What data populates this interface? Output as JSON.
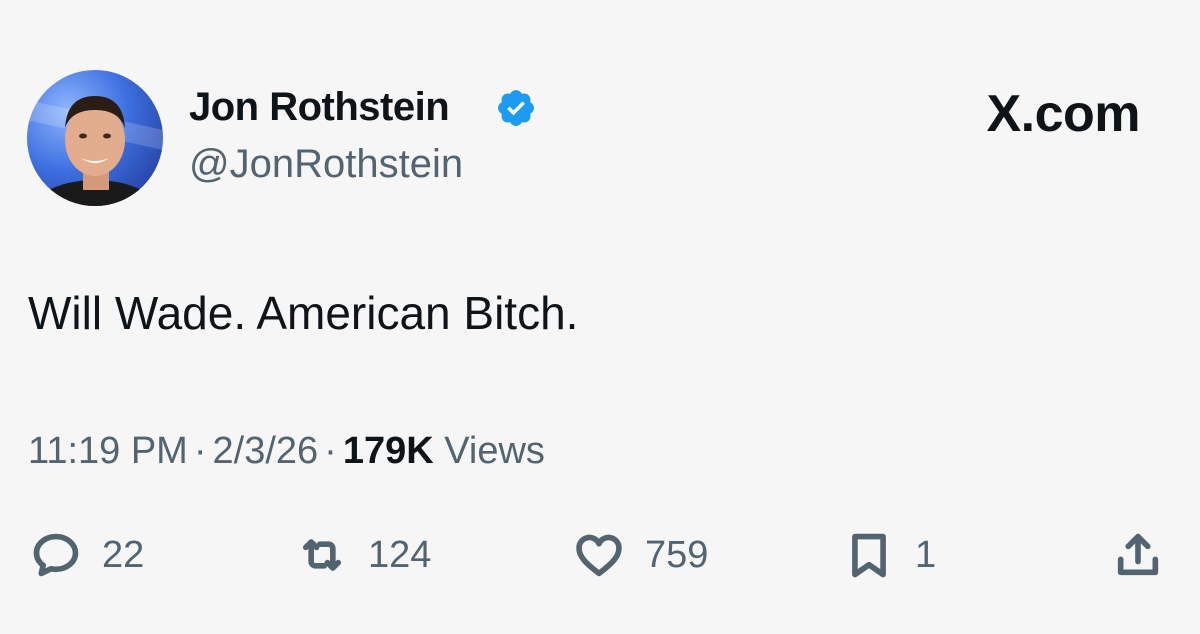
{
  "author": {
    "name": "Jon Rothstein",
    "handle": "@JonRothstein",
    "verified_icon": "verified-badge-icon"
  },
  "brand": {
    "label": "X.com"
  },
  "tweet": {
    "text": "Will Wade. American Bitch."
  },
  "meta": {
    "time": "11:19 PM",
    "separator": "·",
    "date": "2/3/26",
    "views_count": "179K",
    "views_label": "Views"
  },
  "actions": {
    "reply": {
      "icon": "reply-icon",
      "count": "22"
    },
    "retweet": {
      "icon": "retweet-icon",
      "count": "124"
    },
    "like": {
      "icon": "heart-icon",
      "count": "759"
    },
    "bookmark": {
      "icon": "bookmark-icon",
      "count": "1"
    },
    "share": {
      "icon": "share-icon"
    }
  },
  "colors": {
    "text_primary": "#0f1419",
    "text_secondary": "#536471",
    "verified_blue": "#1d9bf0",
    "background": "#f6f6f6"
  }
}
